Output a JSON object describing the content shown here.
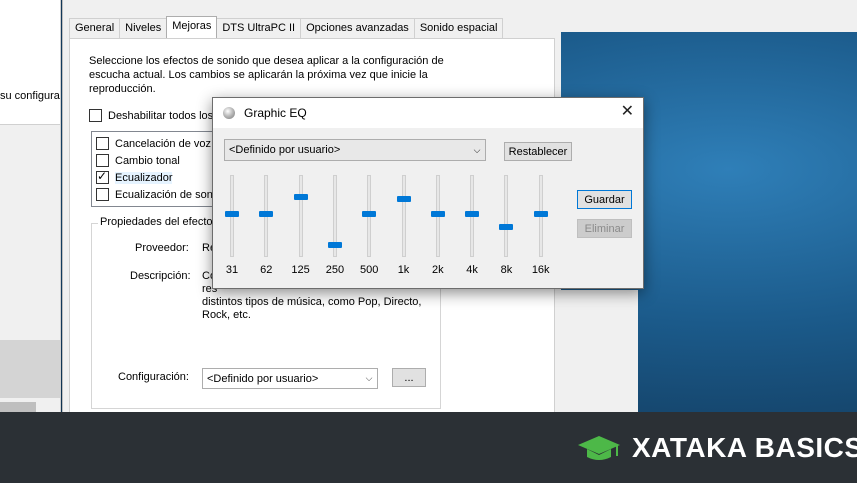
{
  "background_window": {
    "partial_text": "su configura"
  },
  "properties_window": {
    "tabs": [
      {
        "label": "General",
        "active": false
      },
      {
        "label": "Niveles",
        "active": false
      },
      {
        "label": "Mejoras",
        "active": true
      },
      {
        "label": "DTS UltraPC II",
        "active": false
      },
      {
        "label": "Opciones avanzadas",
        "active": false
      },
      {
        "label": "Sonido espacial",
        "active": false
      }
    ],
    "intro_text": "Seleccione los efectos de sonido que desea aplicar a la configuración de escucha actual. Los cambios se aplicarán la próxima vez que inicie la reproducción.",
    "disable_all_label": "Deshabilitar todos los e",
    "disable_all_checked": false,
    "effects": [
      {
        "label": "Cancelación de voz",
        "checked": false
      },
      {
        "label": "Cambio tonal",
        "checked": false
      },
      {
        "label": "Ecualizador",
        "checked": true
      },
      {
        "label": "Ecualización de sonid",
        "checked": false
      }
    ],
    "group_legend": "Propiedades del efecto d",
    "provider_label": "Proveedor:",
    "provider_value": "Re",
    "description_label": "Descripción:",
    "description_value_1": "Co",
    "description_value_2": "res",
    "description_value_3": "distintos tipos de música, como Pop, Directo,",
    "description_value_4": "Rock, etc.",
    "config_label": "Configuración:",
    "config_value": "<Definido por usuario>",
    "more_button": "..."
  },
  "graphic_eq": {
    "title": "Graphic EQ",
    "preset": "<Definido por usuario>",
    "reset_button": "Restablecer",
    "save_button": "Guardar",
    "delete_button": "Eliminar",
    "bands": [
      {
        "freq": "31",
        "level": 0.53
      },
      {
        "freq": "62",
        "level": 0.53
      },
      {
        "freq": "125",
        "level": 0.75
      },
      {
        "freq": "250",
        "level": 0.12
      },
      {
        "freq": "500",
        "level": 0.53
      },
      {
        "freq": "1k",
        "level": 0.73
      },
      {
        "freq": "2k",
        "level": 0.53
      },
      {
        "freq": "4k",
        "level": 0.53
      },
      {
        "freq": "8k",
        "level": 0.35
      },
      {
        "freq": "16k",
        "level": 0.53
      }
    ]
  },
  "banner": {
    "brand": "XATAKA BASICS",
    "accent": "#4db848"
  }
}
